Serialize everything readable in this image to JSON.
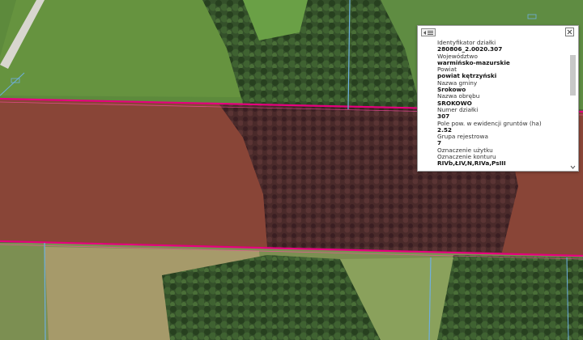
{
  "popup": {
    "fields": [
      {
        "label": "Identyfikator działki",
        "value": "280806_2.0020.307"
      },
      {
        "label": "Województwo",
        "value": "warmińsko-mazurskie"
      },
      {
        "label": "Powiat",
        "value": "powiat kętrzyński"
      },
      {
        "label": "Nazwa gminy",
        "value": "Srokowo"
      },
      {
        "label": "Nazwa obrębu",
        "value": "SROKOWO"
      },
      {
        "label": "Numer działki",
        "value": "307"
      },
      {
        "label": "Pole pow. w ewidencji gruntów (ha)",
        "value": "2.52"
      },
      {
        "label": "Grupa rejestrowa",
        "value": "7"
      },
      {
        "label": "Oznaczenie użytku",
        "value": ""
      },
      {
        "label": "Oznaczenie konturu",
        "value": "RIVb,ŁIV,N,RIVa,PsIII"
      }
    ]
  },
  "colors": {
    "parcel_border": "#e6007e",
    "parcel_fill": "#7a1030",
    "meadow": "#5f8a3e",
    "forest": "#2f4a22"
  }
}
